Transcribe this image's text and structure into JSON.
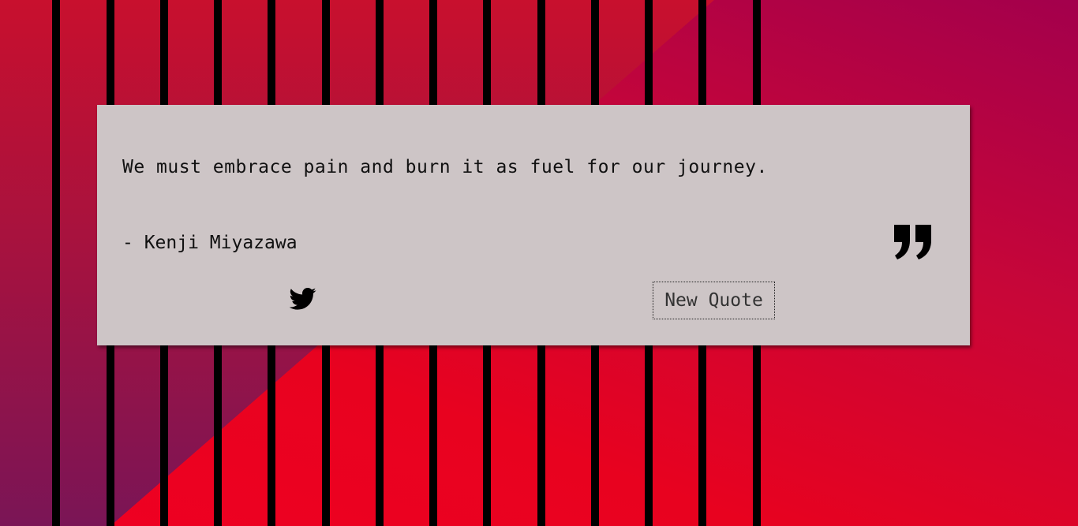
{
  "quote": {
    "text": "We must embrace pain and burn it as fuel for our journey.",
    "author": "- Kenji Miyazawa"
  },
  "actions": {
    "tweet_icon": "twitter-icon",
    "new_quote_label": "New Quote"
  },
  "colors": {
    "card": "#cdc5c6",
    "stripe": "#000000",
    "bg_red": "#e8021f",
    "bg_magenta": "#a3004c",
    "bg_purple": "#7a1556"
  }
}
